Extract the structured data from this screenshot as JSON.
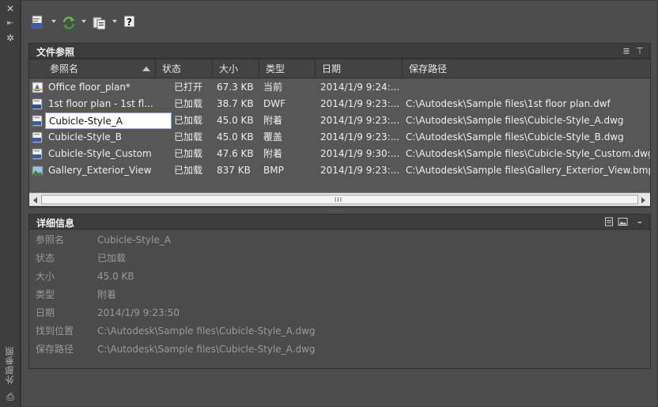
{
  "palette": {
    "side_title": "外部参照",
    "close_glyph": "✕",
    "autohide_glyph": "⇤",
    "properties_glyph": "✲",
    "bottom_glyph": "⎙"
  },
  "toolbar": {
    "attach_dwg_icon": "attach-dwg-icon",
    "refresh_icon": "refresh-icon",
    "change_path_icon": "change-path-icon",
    "help_glyph": "?"
  },
  "file_refs": {
    "title": "文件参照",
    "list_view_glyph": "≣",
    "tree_view_glyph": "⊤",
    "columns": [
      "参照名",
      "状态",
      "大小",
      "类型",
      "日期",
      "保存路径"
    ],
    "rows": [
      {
        "icon": "current-drawing-icon",
        "name": "Office floor_plan*",
        "status": "已打开",
        "size": "67.3 KB",
        "type": "当前",
        "date": "2014/1/9 9:24:...",
        "path": "",
        "selected": false
      },
      {
        "icon": "dwf-file-icon",
        "name": "1st floor plan - 1st fl...",
        "status": "已加载",
        "size": "38.7 KB",
        "type": "DWF",
        "date": "2014/1/9 9:23:...",
        "path": "C:\\Autodesk\\Sample files\\1st floor plan.dwf",
        "selected": false
      },
      {
        "icon": "dwg-file-icon",
        "name": "Cubicle-Style_A",
        "status": "已加载",
        "size": "45.0 KB",
        "type": "附着",
        "date": "2014/1/9 9:23:...",
        "path": "C:\\Autodesk\\Sample files\\Cubicle-Style_A.dwg",
        "selected": true
      },
      {
        "icon": "dwg-file-icon",
        "name": "Cubicle-Style_B",
        "status": "已加载",
        "size": "45.0 KB",
        "type": "覆盖",
        "date": "2014/1/9 9:23:...",
        "path": "C:\\Autodesk\\Sample files\\Cubicle-Style_B.dwg",
        "selected": false
      },
      {
        "icon": "dwg-file-icon",
        "name": "Cubicle-Style_Custom",
        "status": "已加载",
        "size": "47.6 KB",
        "type": "附着",
        "date": "2014/1/9 9:30:...",
        "path": "C:\\Autodesk\\Sample files\\Cubicle-Style_Custom.dwg",
        "selected": false
      },
      {
        "icon": "image-file-icon",
        "name": "Gallery_Exterior_View",
        "status": "已加载",
        "size": "837 KB",
        "type": "BMP",
        "date": "2014/1/9 9:23:...",
        "path": "C:\\Autodesk\\Sample files\\Gallery_Exterior_View.bmp",
        "selected": false
      }
    ],
    "scroll_grip": "III",
    "splitter_grip": "....."
  },
  "details": {
    "title": "详细信息",
    "collapse_glyph": "–",
    "fields": [
      {
        "label": "参照名",
        "value": "Cubicle-Style_A"
      },
      {
        "label": "状态",
        "value": "已加载"
      },
      {
        "label": "大小",
        "value": "45.0 KB"
      },
      {
        "label": "类型",
        "value": "附着"
      },
      {
        "label": "日期",
        "value": "2014/1/9 9:23:50"
      },
      {
        "label": "找到位置",
        "value": "C:\\Autodesk\\Sample files\\Cubicle-Style_A.dwg"
      },
      {
        "label": "保存路径",
        "value": "C:\\Autodesk\\Sample files\\Cubicle-Style_A.dwg"
      }
    ]
  },
  "colors": {
    "background": "#4d4d4d",
    "header_bg": "#3c3c3c",
    "selection_bg": "#ffffff",
    "refresh_green": "#5cc43c"
  }
}
